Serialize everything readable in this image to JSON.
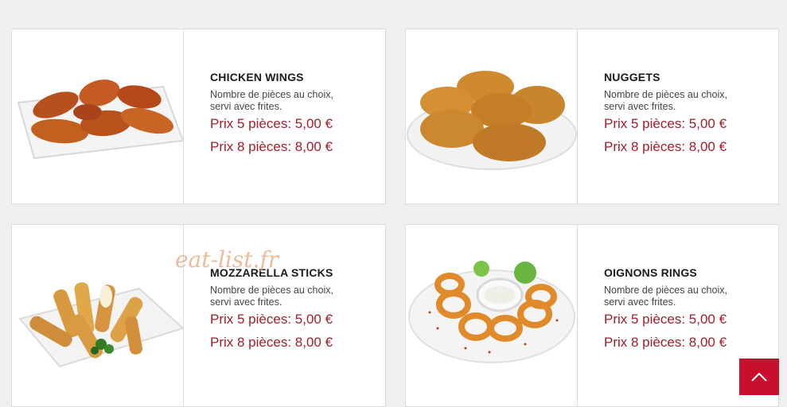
{
  "colors": {
    "price": "#a31d2a",
    "accent": "#c8102e",
    "background": "#efefef"
  },
  "watermark": "eat-list.fr",
  "items": [
    {
      "name": "CHICKEN WINGS",
      "description": "Nombre de pièces au choix, servi avec frites.",
      "price_5": "Prix 5 pièces: 5,00 €",
      "price_8": "Prix 8 pièces: 8,00 €",
      "image": "chicken-wings-photo"
    },
    {
      "name": "NUGGETS",
      "description": "Nombre de pièces au choix, servi avec frites.",
      "price_5": "Prix 5 pièces: 5,00 €",
      "price_8": "Prix 8 pièces: 8,00 €",
      "image": "nuggets-photo"
    },
    {
      "name": "MOZZARELLA STICKS",
      "description": "Nombre de pièces au choix, servi avec frites.",
      "price_5": "Prix 5 pièces: 5,00 €",
      "price_8": "Prix 8 pièces: 8,00 €",
      "image": "mozzarella-sticks-photo"
    },
    {
      "name": "OIGNONS RINGS",
      "description": "Nombre de pièces au choix, servi avec frites.",
      "price_5": "Prix 5 pièces: 5,00 €",
      "price_8": "Prix 8 pièces: 8,00 €",
      "image": "onion-rings-photo"
    }
  ],
  "scroll_top_icon": "chevron-up-icon"
}
